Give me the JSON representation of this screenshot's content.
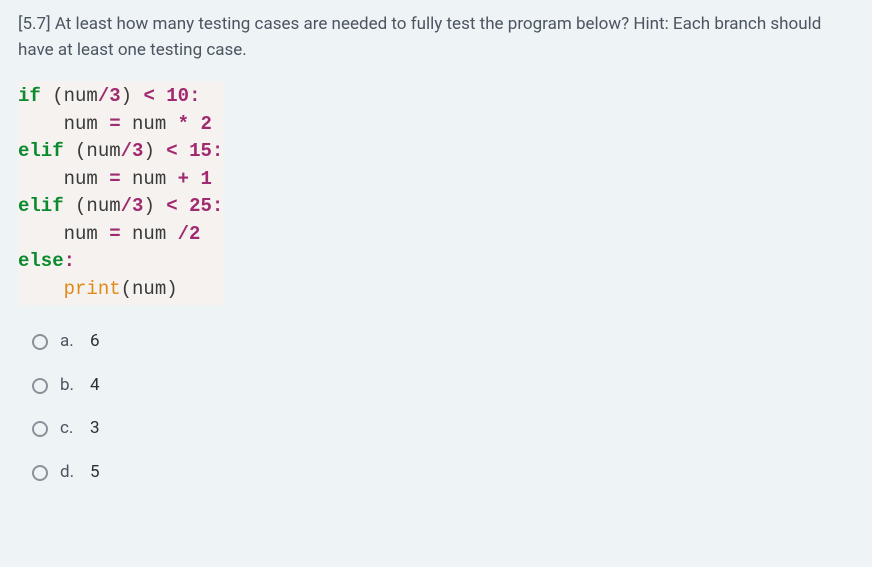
{
  "question": {
    "prefix": "[5.7]",
    "text": "At least how many testing cases are needed to fully test the program below? Hint: Each branch should have at least one testing case."
  },
  "code": {
    "lines": [
      {
        "segments": [
          {
            "t": "if ",
            "cls": "kw"
          },
          {
            "t": "(",
            "cls": "paren"
          },
          {
            "t": "num",
            "cls": "ident"
          },
          {
            "t": "/",
            "cls": "op"
          },
          {
            "t": "3",
            "cls": "num-lit"
          },
          {
            "t": ") ",
            "cls": "paren"
          },
          {
            "t": "< ",
            "cls": "op"
          },
          {
            "t": "10",
            "cls": "num-lit"
          },
          {
            "t": ":",
            "cls": "op"
          }
        ]
      },
      {
        "segments": [
          {
            "t": "    num ",
            "cls": "ident"
          },
          {
            "t": "= ",
            "cls": "op"
          },
          {
            "t": "num ",
            "cls": "ident"
          },
          {
            "t": "* ",
            "cls": "op"
          },
          {
            "t": "2",
            "cls": "num-lit"
          }
        ]
      },
      {
        "segments": [
          {
            "t": "elif ",
            "cls": "kw"
          },
          {
            "t": "(",
            "cls": "paren"
          },
          {
            "t": "num",
            "cls": "ident"
          },
          {
            "t": "/",
            "cls": "op"
          },
          {
            "t": "3",
            "cls": "num-lit"
          },
          {
            "t": ") ",
            "cls": "paren"
          },
          {
            "t": "< ",
            "cls": "op"
          },
          {
            "t": "15",
            "cls": "num-lit"
          },
          {
            "t": ":",
            "cls": "op"
          }
        ]
      },
      {
        "segments": [
          {
            "t": "    num ",
            "cls": "ident"
          },
          {
            "t": "= ",
            "cls": "op"
          },
          {
            "t": "num ",
            "cls": "ident"
          },
          {
            "t": "+ ",
            "cls": "op"
          },
          {
            "t": "1",
            "cls": "num-lit"
          }
        ]
      },
      {
        "segments": [
          {
            "t": "elif ",
            "cls": "kw"
          },
          {
            "t": "(",
            "cls": "paren"
          },
          {
            "t": "num",
            "cls": "ident"
          },
          {
            "t": "/",
            "cls": "op"
          },
          {
            "t": "3",
            "cls": "num-lit"
          },
          {
            "t": ") ",
            "cls": "paren"
          },
          {
            "t": "< ",
            "cls": "op"
          },
          {
            "t": "25",
            "cls": "num-lit"
          },
          {
            "t": ":",
            "cls": "op"
          }
        ]
      },
      {
        "segments": [
          {
            "t": "    num ",
            "cls": "ident"
          },
          {
            "t": "= ",
            "cls": "op"
          },
          {
            "t": "num ",
            "cls": "ident"
          },
          {
            "t": "/",
            "cls": "op"
          },
          {
            "t": "2",
            "cls": "num-lit"
          }
        ]
      },
      {
        "segments": [
          {
            "t": "else",
            "cls": "kw"
          },
          {
            "t": ":",
            "cls": "op"
          }
        ]
      },
      {
        "segments": [
          {
            "t": "    ",
            "cls": "ident"
          },
          {
            "t": "print",
            "cls": "func"
          },
          {
            "t": "(",
            "cls": "paren"
          },
          {
            "t": "num",
            "cls": "ident"
          },
          {
            "t": ")",
            "cls": "paren"
          }
        ]
      }
    ]
  },
  "options": [
    {
      "letter": "a.",
      "value": "6"
    },
    {
      "letter": "b.",
      "value": "4"
    },
    {
      "letter": "c.",
      "value": "3"
    },
    {
      "letter": "d.",
      "value": "5"
    }
  ]
}
